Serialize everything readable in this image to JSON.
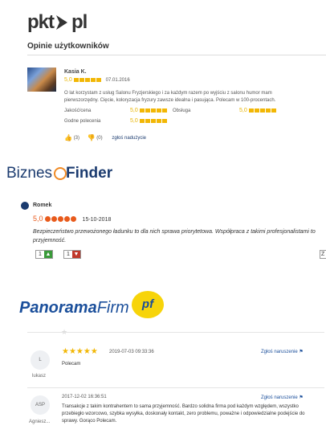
{
  "pkt": {
    "logo_left": "pkt",
    "logo_right": "pl",
    "section_title": "Opinie użytkowników",
    "review": {
      "author": "Kasia K.",
      "rating": "5,0",
      "date": "07.01.2016",
      "text": "O lat korzystam z usług Salonu Fryzjerskiego i za każdym razem po wyjściu z salonu humor mam pierwszorzędny. Cięcie, koloryzacja fryzury zawsze idealna i pasująca. Polecam w 100-procentach.",
      "criteria": [
        {
          "label": "Jakość/cena",
          "value": "5,0"
        },
        {
          "label": "Obsługa",
          "value": "5,0"
        },
        {
          "label": "Godne polecenia",
          "value": "5,0"
        }
      ],
      "likes": "(3)",
      "dislikes": "(0)",
      "report": "zgłoś nadużycie"
    }
  },
  "biznes": {
    "logo_left": "Biznes",
    "logo_right": "Finder",
    "review": {
      "author": "Romek",
      "rating": "5,0",
      "date": "15-10-2018",
      "text": "Bezpieczeństwo przewożonego ładunku to dla nich sprawa priorytetowa. Współpraca z takimi profesjonalistami to przyjemność.",
      "up_count": "1",
      "down_count": "1",
      "cut_label": "Z"
    }
  },
  "panorama": {
    "logo_main": "Panorama",
    "logo_firm": "Firm",
    "badge": "pf",
    "reviews": [
      {
        "avatar": "L",
        "author": "lukasz",
        "stars": "★★★★★",
        "date": "2019-07-03 09:33:36",
        "text": "Polecam",
        "report": "Zgłoś naruszenie ⚑"
      },
      {
        "avatar": "ASP",
        "author": "Agniesz...",
        "date": "2017-12-02 16:36:51",
        "text": "Transakcje z takim kontrahentem to sama przyjemność. Bardzo solidna firma pod każdym względem, wszystko przebiegło wzorcowo, szybka wysyłka, doskonały kontakt, zero problemu, poważne i odpowiedzialne podejście do sprawy. Gorąco Polecam.",
        "report": "Zgłoś naruszenie ⚑"
      }
    ]
  },
  "colors": {
    "star": "#f2b705",
    "biznes_orange": "#e85a1b",
    "navy": "#1b3b6f",
    "panorama_blue": "#1b4f9b",
    "panorama_yellow": "#f7d40a"
  }
}
